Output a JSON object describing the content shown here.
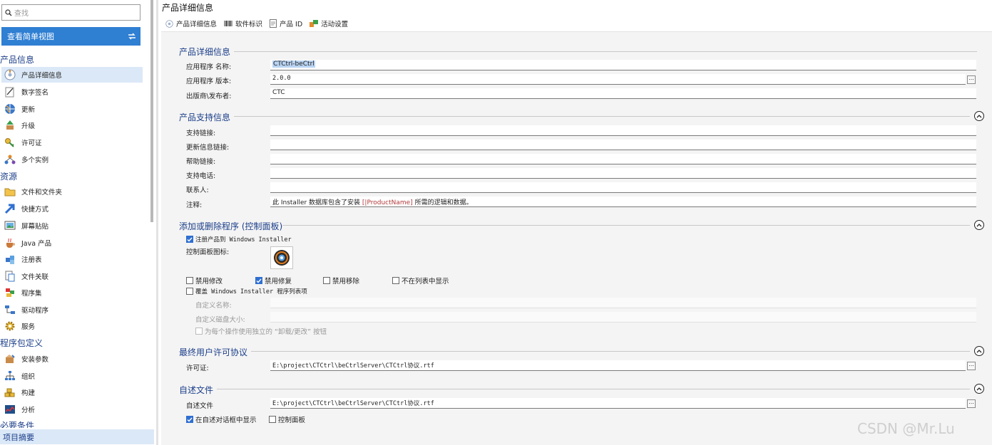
{
  "search": {
    "placeholder": "查找"
  },
  "view_button": {
    "label": "查看简单视图"
  },
  "groups": {
    "product_info": "产品信息",
    "resources": "资源",
    "package_definition": "程序包定义",
    "requirements": "必要条件"
  },
  "nav": {
    "product_details": "产品详细信息",
    "digital_signature": "数字签名",
    "updates": "更新",
    "upgrade": "升级",
    "license": "许可证",
    "multiple_instances": "多个实例",
    "files_folders": "文件和文件夹",
    "shortcuts": "快捷方式",
    "screen_paste": "屏幕贴贴",
    "java_product": "Java 产品",
    "registry": "注册表",
    "file_assoc": "文件关联",
    "assemblies": "程序集",
    "drivers": "驱动程序",
    "services": "服务",
    "install_params": "安装参数",
    "organization": "组织",
    "build": "构建",
    "analysis": "分析"
  },
  "summary": "项目摘要",
  "page_title": "产品详细信息",
  "tabs": [
    "产品详细信息",
    "软件标识",
    "产品 ID",
    "活动设置"
  ],
  "sections": {
    "details": {
      "title": "产品详细信息",
      "app_name_label": "应用程序 名称:",
      "app_name_value": "CTCtrl-beCtrl",
      "app_version_label": "应用程序 版本:",
      "app_version_value": "2.0.0",
      "publisher_label": "出版商\\发布者:",
      "publisher_value": "CTC"
    },
    "support": {
      "title": "产品支持信息",
      "support_link_label": "支持链接:",
      "update_link_label": "更新信息链接:",
      "help_link_label": "帮助链接:",
      "support_phone_label": "支持电话:",
      "contact_label": "联系人:",
      "comments_label": "注释:",
      "comments_prefix": "此 Installer 数据库包含了安装 ",
      "comments_var": "[|ProductName]",
      "comments_suffix": " 所需的逻辑和数据。"
    },
    "arp": {
      "title": "添加或删除程序 (控制面板)",
      "register_label": "注册产品到 Windows Installer",
      "register_checked": true,
      "cp_icon_label": "控制面板图标:",
      "disable_modify": "禁用修改",
      "disable_modify_checked": false,
      "disable_repair": "禁用修复",
      "disable_repair_checked": true,
      "disable_remove": "禁用移除",
      "disable_remove_checked": false,
      "hide_in_list": "不在列表中显示",
      "hide_in_list_checked": false,
      "override_label": "覆盖 Windows Installer 程序列表项",
      "override_checked": false,
      "custom_name_label": "自定义名称:",
      "custom_size_label": "自定义磁盘大小:",
      "separate_button_label": "为每个操作使用独立的 “卸载/更改” 按钮"
    },
    "eula": {
      "title": "最终用户许可协议",
      "license_label": "许可证:",
      "license_value": "E:\\project\\CTCtrl\\beCtrlServer\\CTCtrl协议.rtf"
    },
    "readme": {
      "title": "自述文件",
      "readme_label": "自述文件",
      "readme_value": "E:\\project\\CTCtrl\\beCtrlServer\\CTCtrl协议.rtf",
      "show_in_dialog": "在自述对话框中显示",
      "show_in_dialog_checked": true,
      "control_panel": "控制面板",
      "control_panel_checked": false
    }
  },
  "watermark": "CSDN @Mr.Lu",
  "colors": {
    "accent": "#2f7fd3",
    "section_title": "#1c3f8a",
    "selection": "#dbe8f7"
  }
}
